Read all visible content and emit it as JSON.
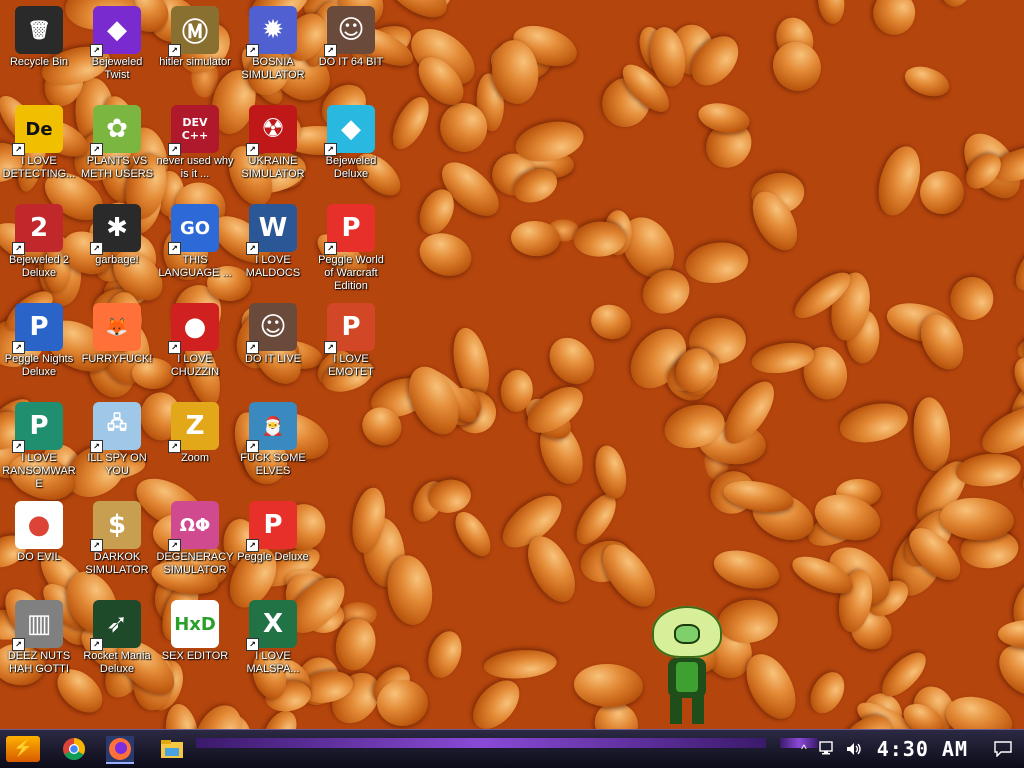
{
  "desktop": {
    "icons": [
      {
        "label": "Recycle Bin",
        "icon": "recycle-bin-icon"
      },
      {
        "label": "I LOVE DETECTING...",
        "icon": "detect-it-easy-icon"
      },
      {
        "label": "Bejeweled 2 Deluxe",
        "icon": "bejeweled2-icon"
      },
      {
        "label": "Peggle Nights Deluxe",
        "icon": "peggle-nights-icon"
      },
      {
        "label": "I LOVE RANSOMWARE",
        "icon": "publisher-icon"
      },
      {
        "label": "DO EVIL",
        "icon": "chrome-icon"
      },
      {
        "label": "DEEZ NUTS HAH GOTTI",
        "icon": "windows-stack-icon"
      },
      {
        "label": "Bejeweled Twist",
        "icon": "bejeweled-twist-icon"
      },
      {
        "label": "PLANTS VS METH USERS",
        "icon": "plants-vs-zombies-icon"
      },
      {
        "label": "garbage!",
        "icon": "paradox-icon"
      },
      {
        "label": "FURRYFUCK!",
        "icon": "firefox-icon"
      },
      {
        "label": "ILL SPY ON YOU",
        "icon": "network-icon"
      },
      {
        "label": "DARKOK SIMULATOR",
        "icon": "money-bag-icon"
      },
      {
        "label": "Rocket Mania Deluxe",
        "icon": "rocket-mania-icon"
      },
      {
        "label": "hitler simulator",
        "icon": "hearts-of-iron-icon"
      },
      {
        "label": "never used why is it ...",
        "icon": "devcpp-icon"
      },
      {
        "label": "THIS LANGUAGE ...",
        "icon": "goland-icon"
      },
      {
        "label": "I LOVE CHUZZIN",
        "icon": "chuzzle-icon"
      },
      {
        "label": "Zoom",
        "icon": "zuma-icon"
      },
      {
        "label": "DEGENERACY SIMULATOR",
        "icon": "fruit-icon"
      },
      {
        "label": "SEX EDITOR",
        "icon": "hxd-icon"
      },
      {
        "label": "BOSNIA SIMULATOR",
        "icon": "mine-icon"
      },
      {
        "label": "UKRAINE SIMULATOR",
        "icon": "radiation-icon"
      },
      {
        "label": "I LOVE MALDOCS",
        "icon": "word-icon"
      },
      {
        "label": "DO IT LIVE",
        "icon": "portrait-icon"
      },
      {
        "label": "FUCK SOME ELVES",
        "icon": "elf-icon"
      },
      {
        "label": "Peggle Deluxe",
        "icon": "peggle-icon"
      },
      {
        "label": "I LOVE MALSPA...",
        "icon": "excel-icon"
      },
      {
        "label": "DO IT 64 BIT",
        "icon": "portrait-64-icon"
      },
      {
        "label": "Bejeweled Deluxe",
        "icon": "diamond-icon"
      },
      {
        "label": "Peggle World of Warcraft Edition",
        "icon": "peggle-wow-icon"
      },
      {
        "label": "I LOVE EMOTET",
        "icon": "powerpoint-icon"
      }
    ],
    "icon_glyphs": [
      "🗑",
      "De",
      "2",
      "P",
      "P",
      "●",
      "▥",
      "◆",
      "✿",
      "✱",
      "🦊",
      "🖧",
      "$",
      "➶",
      "Ⓜ",
      "DEV C++",
      "GO",
      "●",
      "Z",
      "ΩΦ",
      "HxD",
      "✹",
      "☢",
      "W",
      "☺",
      "🎅",
      "P",
      "X",
      "☺",
      "◆",
      "P",
      "P"
    ]
  },
  "taskbar": {
    "start_glyph": "⚡",
    "apps": [
      "chrome-icon",
      "firefox-icon",
      "file-explorer-icon"
    ],
    "tray": {
      "overflow": "^",
      "clock": "4:30 AM"
    }
  }
}
